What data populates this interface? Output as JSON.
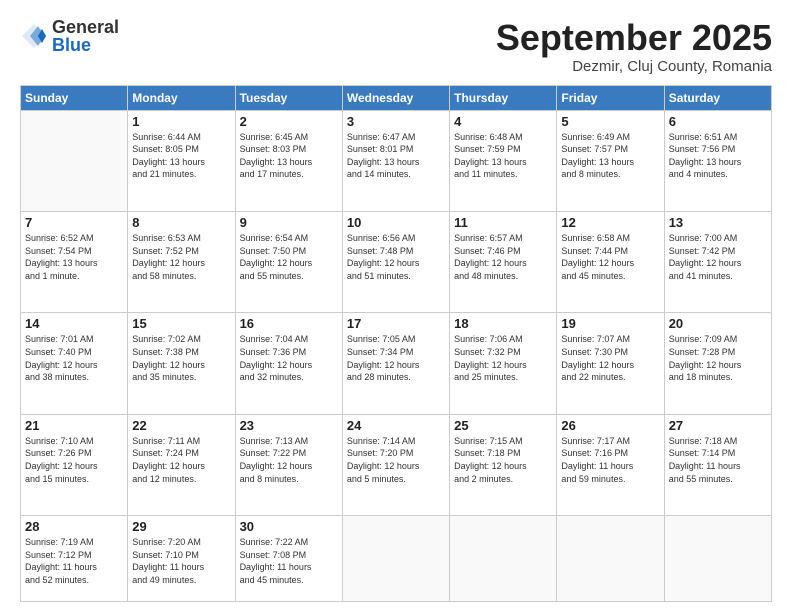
{
  "header": {
    "logo": {
      "general": "General",
      "blue": "Blue"
    },
    "month": "September 2025",
    "location": "Dezmir, Cluj County, Romania"
  },
  "weekdays": [
    "Sunday",
    "Monday",
    "Tuesday",
    "Wednesday",
    "Thursday",
    "Friday",
    "Saturday"
  ],
  "weeks": [
    [
      {
        "day": "",
        "info": ""
      },
      {
        "day": "1",
        "info": "Sunrise: 6:44 AM\nSunset: 8:05 PM\nDaylight: 13 hours\nand 21 minutes."
      },
      {
        "day": "2",
        "info": "Sunrise: 6:45 AM\nSunset: 8:03 PM\nDaylight: 13 hours\nand 17 minutes."
      },
      {
        "day": "3",
        "info": "Sunrise: 6:47 AM\nSunset: 8:01 PM\nDaylight: 13 hours\nand 14 minutes."
      },
      {
        "day": "4",
        "info": "Sunrise: 6:48 AM\nSunset: 7:59 PM\nDaylight: 13 hours\nand 11 minutes."
      },
      {
        "day": "5",
        "info": "Sunrise: 6:49 AM\nSunset: 7:57 PM\nDaylight: 13 hours\nand 8 minutes."
      },
      {
        "day": "6",
        "info": "Sunrise: 6:51 AM\nSunset: 7:56 PM\nDaylight: 13 hours\nand 4 minutes."
      }
    ],
    [
      {
        "day": "7",
        "info": "Sunrise: 6:52 AM\nSunset: 7:54 PM\nDaylight: 13 hours\nand 1 minute."
      },
      {
        "day": "8",
        "info": "Sunrise: 6:53 AM\nSunset: 7:52 PM\nDaylight: 12 hours\nand 58 minutes."
      },
      {
        "day": "9",
        "info": "Sunrise: 6:54 AM\nSunset: 7:50 PM\nDaylight: 12 hours\nand 55 minutes."
      },
      {
        "day": "10",
        "info": "Sunrise: 6:56 AM\nSunset: 7:48 PM\nDaylight: 12 hours\nand 51 minutes."
      },
      {
        "day": "11",
        "info": "Sunrise: 6:57 AM\nSunset: 7:46 PM\nDaylight: 12 hours\nand 48 minutes."
      },
      {
        "day": "12",
        "info": "Sunrise: 6:58 AM\nSunset: 7:44 PM\nDaylight: 12 hours\nand 45 minutes."
      },
      {
        "day": "13",
        "info": "Sunrise: 7:00 AM\nSunset: 7:42 PM\nDaylight: 12 hours\nand 41 minutes."
      }
    ],
    [
      {
        "day": "14",
        "info": "Sunrise: 7:01 AM\nSunset: 7:40 PM\nDaylight: 12 hours\nand 38 minutes."
      },
      {
        "day": "15",
        "info": "Sunrise: 7:02 AM\nSunset: 7:38 PM\nDaylight: 12 hours\nand 35 minutes."
      },
      {
        "day": "16",
        "info": "Sunrise: 7:04 AM\nSunset: 7:36 PM\nDaylight: 12 hours\nand 32 minutes."
      },
      {
        "day": "17",
        "info": "Sunrise: 7:05 AM\nSunset: 7:34 PM\nDaylight: 12 hours\nand 28 minutes."
      },
      {
        "day": "18",
        "info": "Sunrise: 7:06 AM\nSunset: 7:32 PM\nDaylight: 12 hours\nand 25 minutes."
      },
      {
        "day": "19",
        "info": "Sunrise: 7:07 AM\nSunset: 7:30 PM\nDaylight: 12 hours\nand 22 minutes."
      },
      {
        "day": "20",
        "info": "Sunrise: 7:09 AM\nSunset: 7:28 PM\nDaylight: 12 hours\nand 18 minutes."
      }
    ],
    [
      {
        "day": "21",
        "info": "Sunrise: 7:10 AM\nSunset: 7:26 PM\nDaylight: 12 hours\nand 15 minutes."
      },
      {
        "day": "22",
        "info": "Sunrise: 7:11 AM\nSunset: 7:24 PM\nDaylight: 12 hours\nand 12 minutes."
      },
      {
        "day": "23",
        "info": "Sunrise: 7:13 AM\nSunset: 7:22 PM\nDaylight: 12 hours\nand 8 minutes."
      },
      {
        "day": "24",
        "info": "Sunrise: 7:14 AM\nSunset: 7:20 PM\nDaylight: 12 hours\nand 5 minutes."
      },
      {
        "day": "25",
        "info": "Sunrise: 7:15 AM\nSunset: 7:18 PM\nDaylight: 12 hours\nand 2 minutes."
      },
      {
        "day": "26",
        "info": "Sunrise: 7:17 AM\nSunset: 7:16 PM\nDaylight: 11 hours\nand 59 minutes."
      },
      {
        "day": "27",
        "info": "Sunrise: 7:18 AM\nSunset: 7:14 PM\nDaylight: 11 hours\nand 55 minutes."
      }
    ],
    [
      {
        "day": "28",
        "info": "Sunrise: 7:19 AM\nSunset: 7:12 PM\nDaylight: 11 hours\nand 52 minutes."
      },
      {
        "day": "29",
        "info": "Sunrise: 7:20 AM\nSunset: 7:10 PM\nDaylight: 11 hours\nand 49 minutes."
      },
      {
        "day": "30",
        "info": "Sunrise: 7:22 AM\nSunset: 7:08 PM\nDaylight: 11 hours\nand 45 minutes."
      },
      {
        "day": "",
        "info": ""
      },
      {
        "day": "",
        "info": ""
      },
      {
        "day": "",
        "info": ""
      },
      {
        "day": "",
        "info": ""
      }
    ]
  ]
}
